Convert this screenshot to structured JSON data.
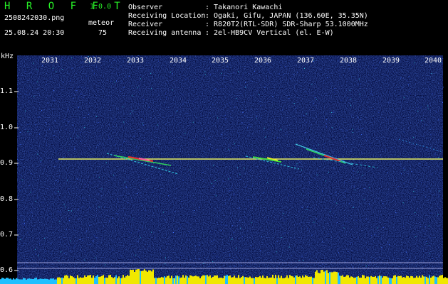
{
  "header": {
    "brand": "H R O F F T",
    "version": "1.0.0",
    "filename": "2508242030.png",
    "mode": "meteor",
    "datetime": "25.08.24 20:30",
    "count": "75",
    "meta": [
      {
        "label": "Observer",
        "value": ": Takanori Kawachi"
      },
      {
        "label": "Receiving Location",
        "value": ": Ogaki, Gifu, JAPAN (136.60E, 35.35N)"
      },
      {
        "label": "Receiver",
        "value": ": R820T2(RTL-SDR) SDR-Sharp 53.1000MHz"
      },
      {
        "label": "Receiving antenna",
        "value": ": 2el-HB9CV Vertical (el. E-W)"
      }
    ]
  },
  "axis": {
    "y_unit": "kHz",
    "y_ticks": [
      "1.1",
      "1.0",
      "0.9",
      "0.8",
      "0.7",
      "0.6"
    ],
    "x_ticks": [
      "2031",
      "2032",
      "2033",
      "2034",
      "2035",
      "2036",
      "2037",
      "2038",
      "2039",
      "2040"
    ]
  },
  "colors": {
    "background": "#000000",
    "noise": "#0a1a6e",
    "carrier": "#e8f060",
    "level": "#f0e800",
    "level_low": "#20c0ff",
    "header_green": "#27f227"
  }
}
